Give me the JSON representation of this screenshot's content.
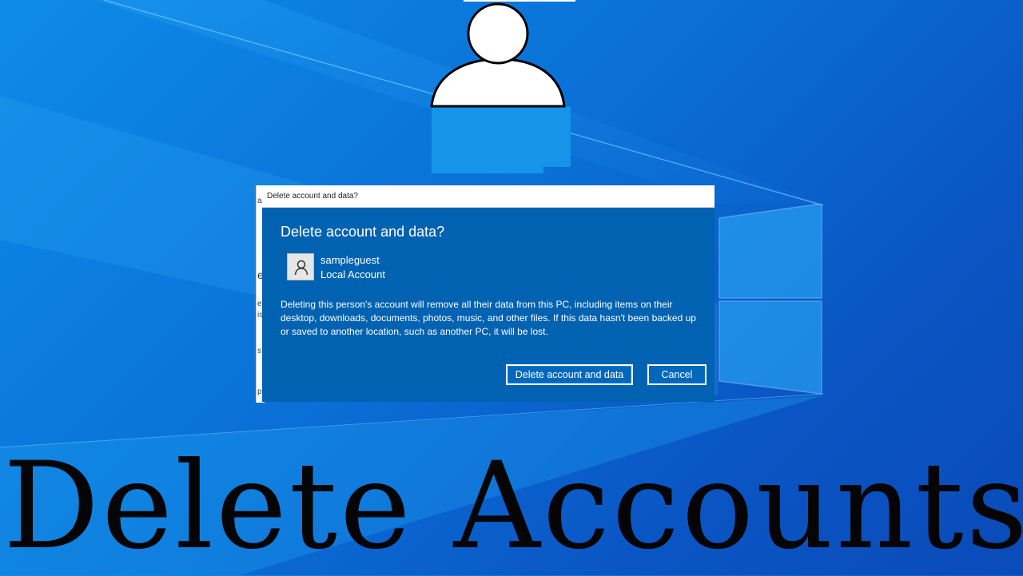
{
  "background": {
    "colors": {
      "primary": "#0a6fd6",
      "light": "#0d8be8",
      "dark": "#0a4bb8"
    },
    "logo_icon": "windows-logo-icon",
    "figure_icon": "user-silhouette-icon"
  },
  "background_window": {
    "fragments": [
      "a",
      "e",
      "e",
      "is",
      "s",
      "p"
    ]
  },
  "dialog": {
    "window_title": "Delete account and data?",
    "heading": "Delete account and data?",
    "account": {
      "icon": "user-icon",
      "name": "sampleguest",
      "type": "Local Account"
    },
    "description": "Deleting this person's account will remove all their data from this PC, including items on their desktop, downloads, documents, photos, music, and other files. If this data hasn't been backed up or saved to another location, such as another PC, it will be lost.",
    "buttons": {
      "delete_label": "Delete account and data",
      "cancel_label": "Cancel"
    },
    "colors": {
      "body": "#0062b0",
      "button": "#0068bc",
      "text": "#ffffff"
    }
  },
  "banner": {
    "text": "Delete Accounts"
  }
}
